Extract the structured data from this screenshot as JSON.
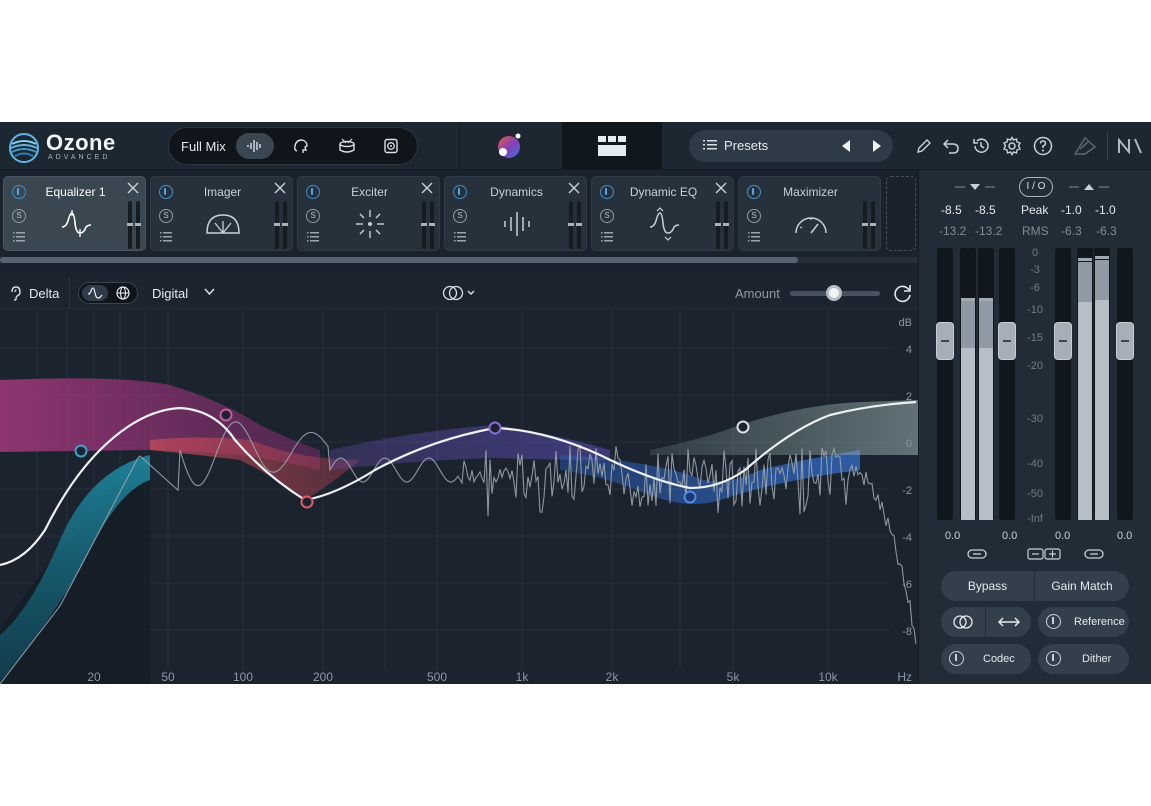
{
  "app": {
    "title": "Ozone",
    "subtitle": "ADVANCED"
  },
  "topbar": {
    "view_label": "Full Mix",
    "presets_label": "Presets",
    "icons": [
      "spectrum-icon",
      "headphones-icon",
      "drum-icon",
      "speaker-icon",
      "pencil-icon",
      "undo-icon",
      "history-icon",
      "gear-icon",
      "help-icon",
      "ni-logo-icon",
      "ni-icon"
    ]
  },
  "modules": [
    {
      "name": "Equalizer 1",
      "icon": "eq-curve-icon",
      "selected": true
    },
    {
      "name": "Imager",
      "icon": "imager-icon",
      "selected": false
    },
    {
      "name": "Exciter",
      "icon": "exciter-icon",
      "selected": false
    },
    {
      "name": "Dynamics",
      "icon": "dynamics-icon",
      "selected": false
    },
    {
      "name": "Dynamic EQ",
      "icon": "dynamic-eq-icon",
      "selected": false
    },
    {
      "name": "Maximizer",
      "icon": "maximizer-icon",
      "selected": false
    }
  ],
  "module_solo_label": "S",
  "eq_toolbar": {
    "delta_label": "Delta",
    "digital_label": "Digital",
    "amount_label": "Amount",
    "amount_value": 0.5
  },
  "eq_graph": {
    "db_label": "dB",
    "hz_label": "Hz",
    "db_ticks": [
      "4",
      "2",
      "0",
      "-2",
      "-4",
      "-6",
      "-8"
    ],
    "freq_ticks": [
      "20",
      "50",
      "100",
      "200",
      "500",
      "1k",
      "2k",
      "5k",
      "10k"
    ]
  },
  "meters": {
    "input_peak": [
      "-8.5",
      "-8.5"
    ],
    "input_rms": [
      "-13.2",
      "-13.2"
    ],
    "output_peak": [
      "-1.0",
      "-1.0"
    ],
    "output_rms": [
      "-6.3",
      "-6.3"
    ],
    "peak_label": "Peak",
    "rms_label": "RMS",
    "io_label": "I / O",
    "scale": [
      "0",
      "-3",
      "-6",
      "-10",
      "-15",
      "-20",
      "-30",
      "-40",
      "-50",
      "-Inf"
    ],
    "fader_values": [
      "0.0",
      "0.0",
      "0.0",
      "0.0"
    ]
  },
  "buttons": {
    "bypass": "Bypass",
    "gain_match": "Gain Match",
    "reference": "Reference",
    "codec": "Codec",
    "dither": "Dither"
  }
}
